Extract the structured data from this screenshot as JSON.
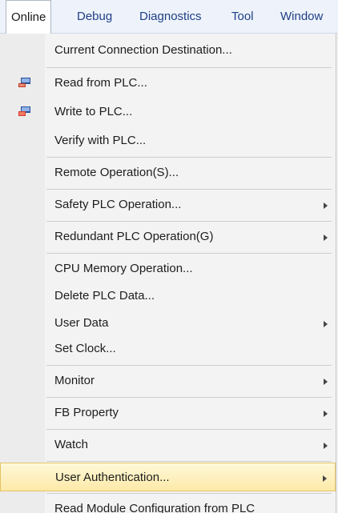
{
  "menubar": {
    "items": [
      {
        "label": "Online",
        "active": true
      },
      {
        "label": "Debug"
      },
      {
        "label": "Diagnostics"
      },
      {
        "label": "Tool"
      },
      {
        "label": "Window"
      }
    ]
  },
  "menu": {
    "items": [
      {
        "label": "Current Connection Destination..."
      },
      {
        "label": "Read from PLC...",
        "icon": "read-from-plc-icon"
      },
      {
        "label": "Write to PLC...",
        "icon": "write-to-plc-icon"
      },
      {
        "label": "Verify with PLC..."
      },
      {
        "label": "Remote Operation(S)..."
      },
      {
        "label": "Safety PLC Operation...",
        "submenu": true
      },
      {
        "label": "Redundant PLC Operation(G)",
        "submenu": true
      },
      {
        "label": "CPU Memory Operation..."
      },
      {
        "label": "Delete PLC Data..."
      },
      {
        "label": "User Data",
        "submenu": true
      },
      {
        "label": "Set Clock..."
      },
      {
        "label": "Monitor",
        "submenu": true
      },
      {
        "label": "FB Property",
        "submenu": true
      },
      {
        "label": "Watch",
        "submenu": true
      },
      {
        "label": "User Authentication...",
        "submenu": true,
        "highlighted": true
      },
      {
        "label": "Read Module Configuration from PLC"
      }
    ]
  },
  "colors": {
    "menubar_text": "#1e3f86",
    "highlight_border": "#e5c365",
    "highlight_fill": "#fdeaa8",
    "icon_blue": "#2a4f9a",
    "icon_red": "#d83b2a"
  }
}
